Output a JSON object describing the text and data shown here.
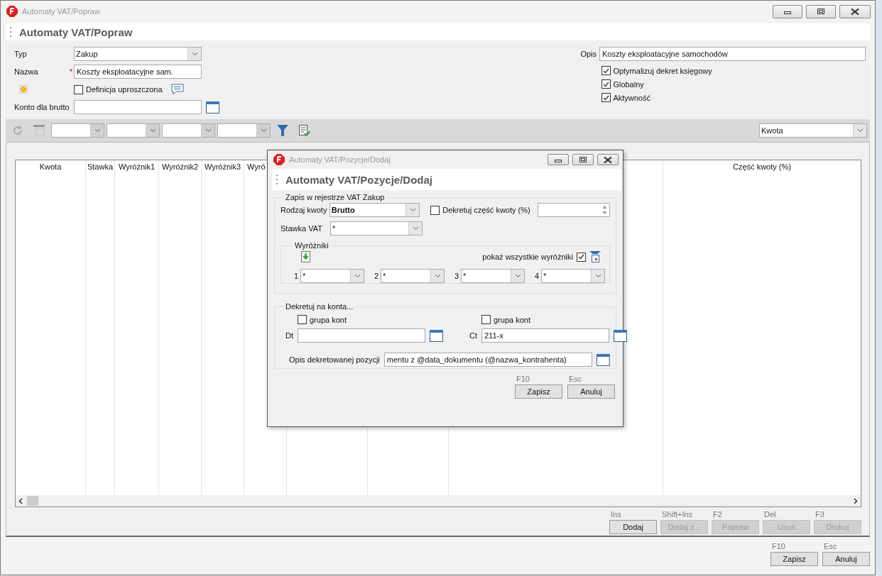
{
  "window": {
    "title": "Automaty VAT/Popraw"
  },
  "header": {
    "title": "Automaty VAT/Popraw"
  },
  "form": {
    "typ": {
      "label": "Typ",
      "value": "Zakup"
    },
    "nazwa": {
      "label": "Nazwa",
      "required_mark": "*",
      "value": "Koszty eksploatacyjne sam."
    },
    "definicja": {
      "label": "Definicja uproszczona",
      "checked": false
    },
    "konto": {
      "label": "Konto dla brutto"
    },
    "opis": {
      "label": "Opis",
      "value": "Koszty eksploatacyjne samochodów"
    },
    "options": [
      {
        "label": "Optymalizuj dekret księgowy",
        "checked": true
      },
      {
        "label": "Globalny",
        "checked": true
      },
      {
        "label": "Aktywność",
        "checked": true
      }
    ]
  },
  "toolbar": {
    "sort_field": "Kwota"
  },
  "table": {
    "columns": [
      {
        "label": "Kwota"
      },
      {
        "label": "Stawka"
      },
      {
        "label": "Wyróżnik1"
      },
      {
        "label": "Wyróżnik2"
      },
      {
        "label": "Wyróżnik3"
      },
      {
        "label": "Wyró"
      },
      {},
      {},
      {},
      {
        "label": "Część kwoty (%)"
      }
    ]
  },
  "actions": [
    {
      "shortcut": "Ins",
      "label": "Dodaj",
      "disabled": false
    },
    {
      "shortcut": "Shift+Ins",
      "label": "Dodaj z...",
      "disabled": true
    },
    {
      "shortcut": "F2",
      "label": "Popraw",
      "disabled": true
    },
    {
      "shortcut": "Del",
      "label": "Usuń",
      "disabled": true
    },
    {
      "shortcut": "F3",
      "label": "Drukuj",
      "disabled": true
    }
  ],
  "footer_buttons": [
    {
      "shortcut": "F10",
      "label": "Zapisz"
    },
    {
      "shortcut": "Esc",
      "label": "Anuluj"
    }
  ],
  "dialog": {
    "title": "Automaty VAT/Pozycje/Dodaj",
    "header": "Automaty VAT/Pozycje/Dodaj",
    "register": {
      "legend": "Zapis w rejestrze VAT Zakup",
      "rodzaj": {
        "label": "Rodzaj kwoty",
        "value": "Brutto"
      },
      "dekretuj": {
        "label": "Dekretuj część kwoty (%)",
        "checked": false
      },
      "stawka": {
        "label": "Stawka VAT",
        "value": "*"
      },
      "wyrozniki": {
        "legend": "Wyróżniki",
        "show_all": {
          "label": "pokaż wszystkie wyróżniki",
          "checked": true
        },
        "fields": [
          {
            "number": "1",
            "value": "*"
          },
          {
            "number": "2",
            "value": "*"
          },
          {
            "number": "3",
            "value": "*"
          },
          {
            "number": "4",
            "value": "*"
          }
        ]
      }
    },
    "accounts": {
      "legend": "Dekretuj na konta...",
      "dt": {
        "label": "Dt",
        "group_label": "grupa kont",
        "group_checked": false
      },
      "ct": {
        "label": "Ct",
        "group_label": "grupa kont",
        "group_checked": false,
        "value": "211-x"
      },
      "opis": {
        "label": "Opis dekretowanej pozycji",
        "value": "mentu z @data_dokumentu (@nazwa_kontrahenta)"
      }
    },
    "buttons": [
      {
        "shortcut": "F10",
        "label": "Zapisz"
      },
      {
        "shortcut": "Esc",
        "label": "Anuluj"
      }
    ]
  }
}
